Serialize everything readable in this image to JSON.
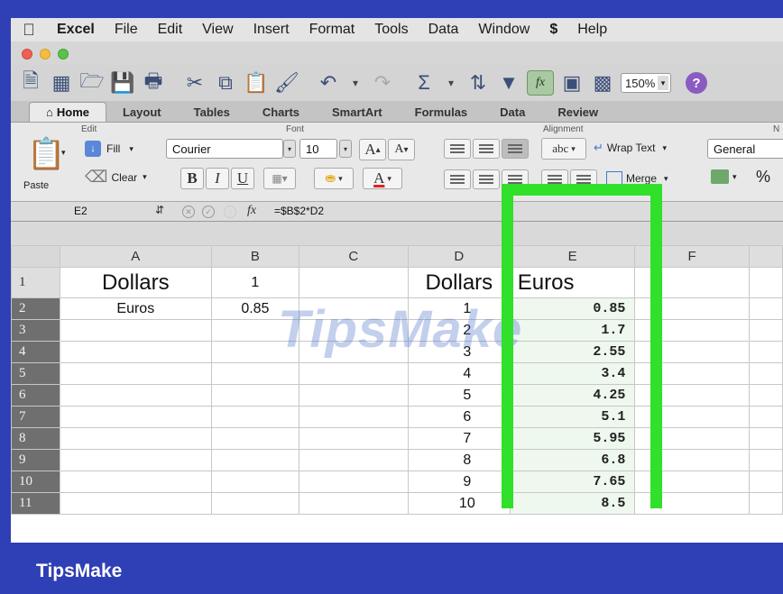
{
  "menubar": {
    "items": [
      "Excel",
      "File",
      "Edit",
      "View",
      "Insert",
      "Format",
      "Tools",
      "Data",
      "Window",
      "Help"
    ]
  },
  "toolbar": {
    "zoom": "150%"
  },
  "ribbon_tabs": [
    "Home",
    "Layout",
    "Tables",
    "Charts",
    "SmartArt",
    "Formulas",
    "Data",
    "Review"
  ],
  "ribbon": {
    "edit_label": "Edit",
    "font_label": "Font",
    "alignment_label": "Alignment",
    "number_label": "N",
    "fill": "Fill",
    "clear": "Clear",
    "paste": "Paste",
    "font_name": "Courier",
    "font_size": "10",
    "grow_font": "A",
    "shrink_font": "A",
    "bold": "B",
    "italic": "I",
    "underline": "U",
    "font_color": "A",
    "orientation": "abc",
    "wrap_text": "Wrap Text",
    "merge": "Merge",
    "number_format": "General",
    "percent": "%"
  },
  "formula_bar": {
    "cell_ref": "E2",
    "fx": "fx",
    "formula": "=$B$2*D2"
  },
  "sheet": {
    "columns": [
      "A",
      "B",
      "C",
      "D",
      "E",
      "F"
    ],
    "rows": [
      {
        "n": "1",
        "A": "Dollars",
        "B": "1",
        "C": "",
        "D": "Dollars",
        "E": "Euros"
      },
      {
        "n": "2",
        "A": "Euros",
        "B": "0.85",
        "C": "",
        "D": "1",
        "E": "0.85"
      },
      {
        "n": "3",
        "A": "",
        "B": "",
        "C": "",
        "D": "2",
        "E": "1.7"
      },
      {
        "n": "4",
        "A": "",
        "B": "",
        "C": "",
        "D": "3",
        "E": "2.55"
      },
      {
        "n": "5",
        "A": "",
        "B": "",
        "C": "",
        "D": "4",
        "E": "3.4"
      },
      {
        "n": "6",
        "A": "",
        "B": "",
        "C": "",
        "D": "5",
        "E": "4.25"
      },
      {
        "n": "7",
        "A": "",
        "B": "",
        "C": "",
        "D": "6",
        "E": "5.1"
      },
      {
        "n": "8",
        "A": "",
        "B": "",
        "C": "",
        "D": "7",
        "E": "5.95"
      },
      {
        "n": "9",
        "A": "",
        "B": "",
        "C": "",
        "D": "8",
        "E": "6.8"
      },
      {
        "n": "10",
        "A": "",
        "B": "",
        "C": "",
        "D": "9",
        "E": "7.65"
      },
      {
        "n": "11",
        "A": "",
        "B": "",
        "C": "",
        "D": "10",
        "E": "8.5"
      }
    ]
  },
  "watermark": "TipsMake",
  "banner": "TipsMake",
  "colors": {
    "highlight": "#31e02b",
    "banner": "#2f3fb5"
  }
}
